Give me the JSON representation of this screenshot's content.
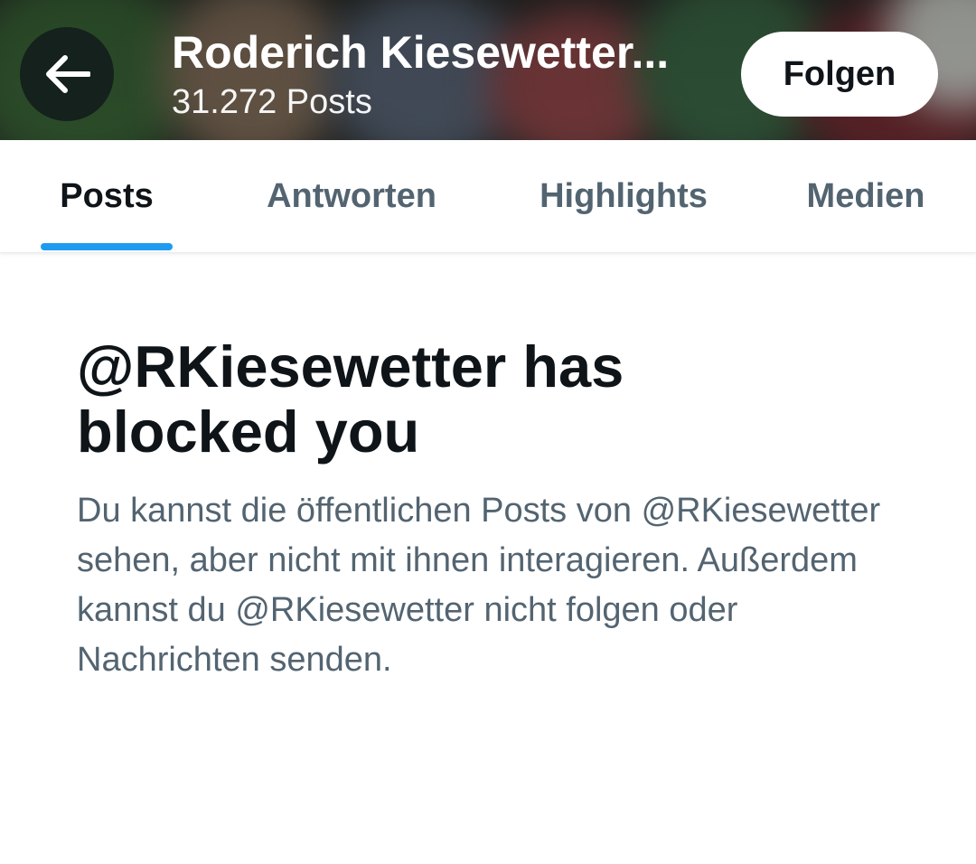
{
  "header": {
    "back_icon": "arrow-left-icon",
    "profile_name": "Roderich Kiesewetter...",
    "post_count": "31.272 Posts",
    "follow_label": "Folgen"
  },
  "tabs": [
    {
      "label": "Posts",
      "active": true
    },
    {
      "label": "Antworten",
      "active": false
    },
    {
      "label": "Highlights",
      "active": false
    },
    {
      "label": "Medien",
      "active": false
    }
  ],
  "blocked": {
    "title": "@RKiesewetter has blocked you",
    "description": "Du kannst die öffentlichen Posts von @RKiesewetter sehen, aber nicht mit ihnen interagieren. Außerdem kannst du @RKiesewetter nicht folgen oder Nachrichten senden."
  },
  "colors": {
    "accent": "#1d9bf0",
    "text_primary": "#0f1419",
    "text_secondary": "#536471"
  }
}
